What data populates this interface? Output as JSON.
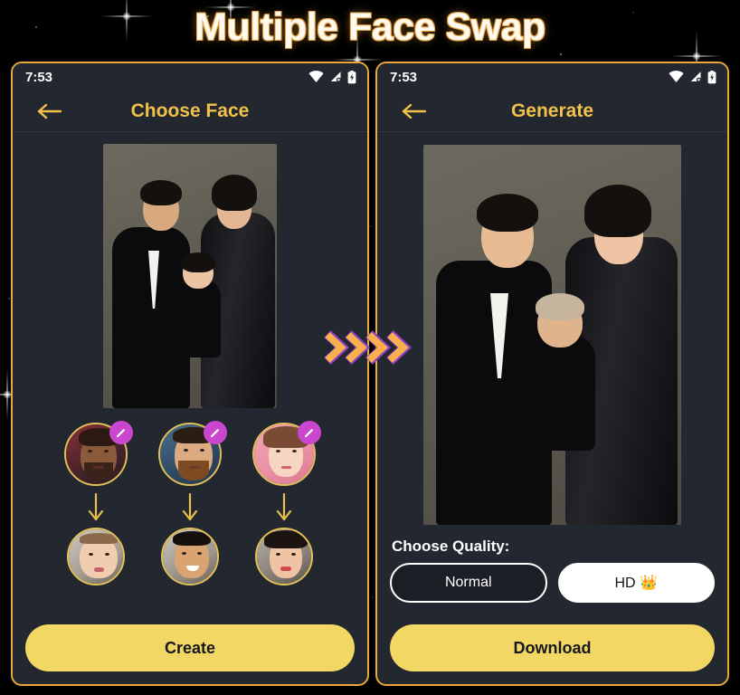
{
  "banner": {
    "title": "Multiple Face Swap"
  },
  "theme": {
    "page_bg": "#000000",
    "phone_bg": "#23272F",
    "phone_border": "#E9A83B",
    "accent_gold": "#F2C14A",
    "cta_bg": "#F2D765",
    "cta_text": "#16181D",
    "badge_purple": "#CB46CE",
    "chevron_fill": "#F8AF4E",
    "chevron_outline": "#8E3FC4",
    "title_text": "#FFF9F0",
    "title_outline": "#E8A33D"
  },
  "transition": {
    "icon": "double-chevron-right-icon",
    "count": 4
  },
  "phone_left": {
    "status": {
      "time": "7:53",
      "icons": [
        "wifi-icon",
        "cellular-signal-off-icon",
        "battery-charging-icon"
      ]
    },
    "appbar": {
      "back_icon": "back-arrow-icon",
      "title": "Choose Face"
    },
    "hero_photo": {
      "name": "source-photo",
      "alt": "Family portrait: man in black suit, baby, woman in black dress"
    },
    "swap_pairs": [
      {
        "source_label": "face-source-1",
        "target_label": "face-target-1",
        "edit_icon": "pencil-icon",
        "arrow_icon": "arrow-down-icon"
      },
      {
        "source_label": "face-source-2",
        "target_label": "face-target-2",
        "edit_icon": "pencil-icon",
        "arrow_icon": "arrow-down-icon"
      },
      {
        "source_label": "face-source-3",
        "target_label": "face-target-3",
        "edit_icon": "pencil-icon",
        "arrow_icon": "arrow-down-icon"
      }
    ],
    "cta": {
      "label": "Create"
    }
  },
  "phone_right": {
    "status": {
      "time": "7:53",
      "icons": [
        "wifi-icon",
        "cellular-signal-off-icon",
        "battery-charging-icon"
      ]
    },
    "appbar": {
      "back_icon": "back-arrow-icon",
      "title": "Generate"
    },
    "result_photo": {
      "name": "result-photo",
      "alt": "Family portrait with swapped faces"
    },
    "quality": {
      "label": "Choose Quality:",
      "options": [
        {
          "label": "Normal",
          "selected": false
        },
        {
          "label": "HD 👑",
          "selected": true
        }
      ]
    },
    "cta": {
      "label": "Download"
    }
  }
}
